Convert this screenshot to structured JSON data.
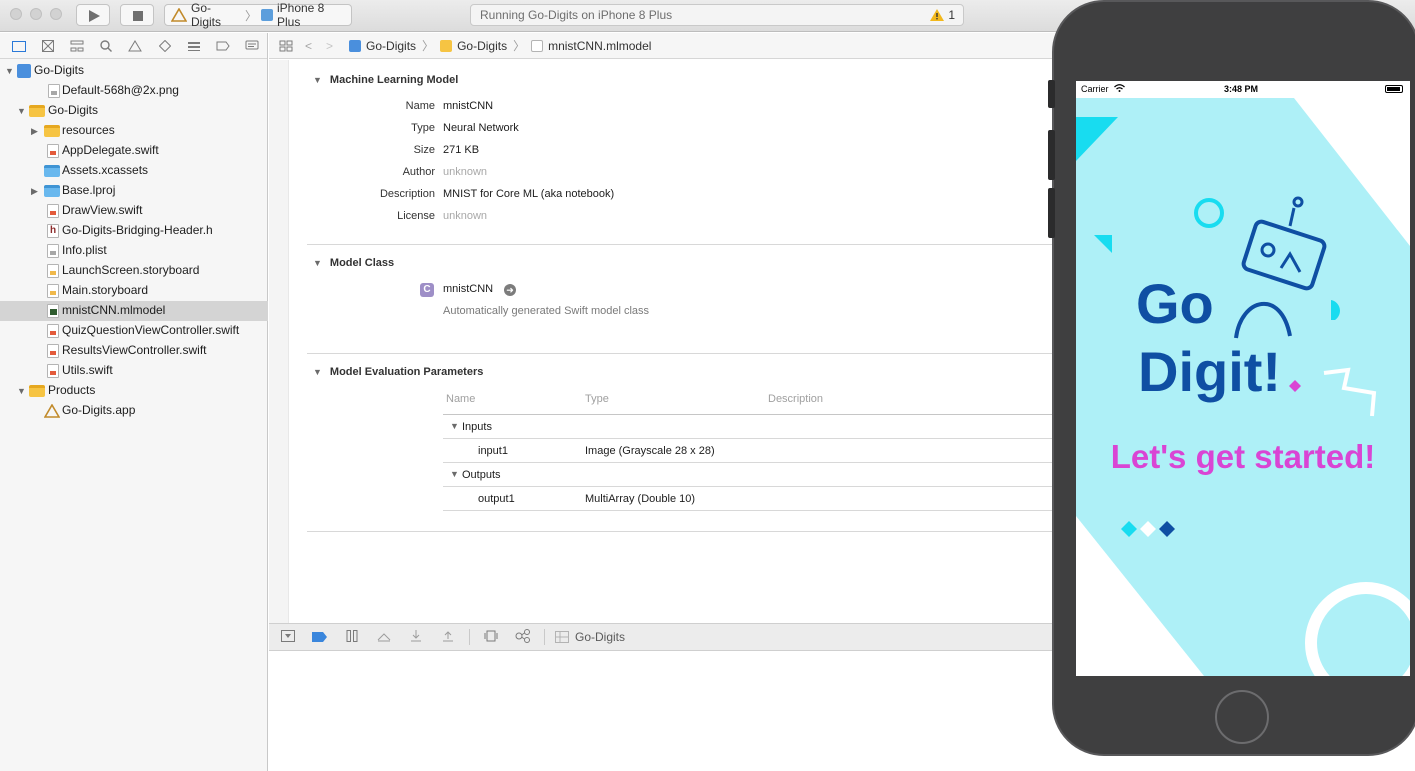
{
  "toolbar": {
    "scheme_project": "Go-Digits",
    "scheme_separator": "〉",
    "scheme_device": "iPhone 8 Plus",
    "status_text": "Running Go-Digits on iPhone 8 Plus",
    "warning_count": "1"
  },
  "navigator": {
    "items": [
      {
        "label": "Go-Digits"
      },
      {
        "label": "Default-568h@2x.png"
      },
      {
        "label": "Go-Digits"
      },
      {
        "label": "resources"
      },
      {
        "label": "AppDelegate.swift"
      },
      {
        "label": "Assets.xcassets"
      },
      {
        "label": "Base.lproj"
      },
      {
        "label": "DrawView.swift"
      },
      {
        "label": "Go-Digits-Bridging-Header.h"
      },
      {
        "label": "Info.plist"
      },
      {
        "label": "LaunchScreen.storyboard"
      },
      {
        "label": "Main.storyboard"
      },
      {
        "label": "mnistCNN.mlmodel"
      },
      {
        "label": "QuizQuestionViewController.swift"
      },
      {
        "label": "ResultsViewController.swift"
      },
      {
        "label": "Utils.swift"
      },
      {
        "label": "Products"
      },
      {
        "label": "Go-Digits.app"
      }
    ]
  },
  "jumpbar": {
    "crumbs": [
      "Go-Digits",
      "Go-Digits",
      "mnistCNN.mlmodel"
    ]
  },
  "editor": {
    "ml_model": {
      "title": "Machine Learning Model",
      "rows": [
        {
          "label": "Name",
          "value": "mnistCNN"
        },
        {
          "label": "Type",
          "value": "Neural Network"
        },
        {
          "label": "Size",
          "value": "271 KB"
        },
        {
          "label": "Author",
          "value": "unknown"
        },
        {
          "label": "Description",
          "value": "MNIST for Core ML (aka notebook)"
        },
        {
          "label": "License",
          "value": "unknown"
        }
      ]
    },
    "model_class": {
      "title": "Model Class",
      "badge": "C",
      "class_name": "mnistCNN",
      "note": "Automatically generated Swift model class"
    },
    "evaluation": {
      "title": "Model Evaluation Parameters",
      "headers": {
        "name": "Name",
        "type": "Type",
        "description": "Description"
      },
      "inputs_label": "Inputs",
      "input_name": "input1",
      "input_type": "Image (Grayscale 28 x 28)",
      "outputs_label": "Outputs",
      "output_name": "output1",
      "output_type": "MultiArray (Double 10)"
    }
  },
  "debugbar": {
    "target": "Go-Digits"
  },
  "simulator": {
    "carrier": "Carrier",
    "time": "3:48 PM",
    "logo_line1": "Go",
    "logo_line2": "Digit!",
    "tagline": "Let's get started!",
    "colors": {
      "background": "#aef0f7",
      "cyan_accent": "#18dcf0",
      "logo_blue": "#0f4fa3",
      "tagline_magenta": "#d945d4"
    }
  }
}
